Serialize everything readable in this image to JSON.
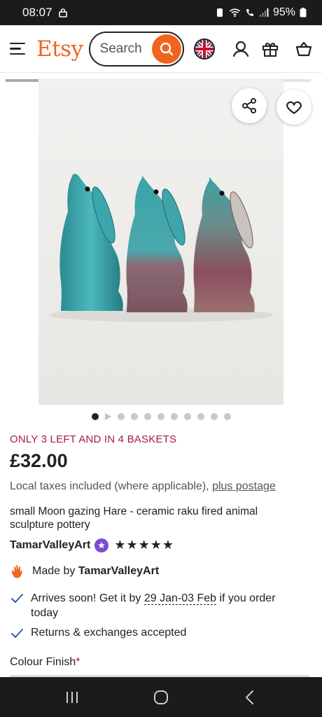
{
  "status_bar": {
    "time": "08:07",
    "battery": "95%"
  },
  "header": {
    "logo": "Etsy",
    "search_placeholder": "Search"
  },
  "listing": {
    "stock_message": "ONLY 3 LEFT AND IN 4 BASKETS",
    "price": "£32.00",
    "tax_note": "Local taxes included (where applicable),",
    "plus_postage": "plus postage",
    "title": "small Moon gazing Hare - ceramic raku fired animal sculpture pottery",
    "shop_name": "TamarValleyArt",
    "rating_stars": "★★★★★",
    "rating": 5,
    "made_by_prefix": "Made by",
    "made_by_shop": "TamarValleyArt",
    "arrives_prefix": "Arrives soon! Get it by",
    "arrives_dates": "29 Jan-03 Feb",
    "arrives_suffix": "if you order today",
    "returns": "Returns & exchanges accepted",
    "colour_label": "Colour Finish",
    "required_mark": "*"
  },
  "gallery": {
    "image_count": 11,
    "current_index": 0
  },
  "colors": {
    "etsy_orange": "#f1641e",
    "sale_red": "#a61a4b",
    "check_blue": "#2f5fa8",
    "star_seller_purple": "#7a4bd0"
  }
}
